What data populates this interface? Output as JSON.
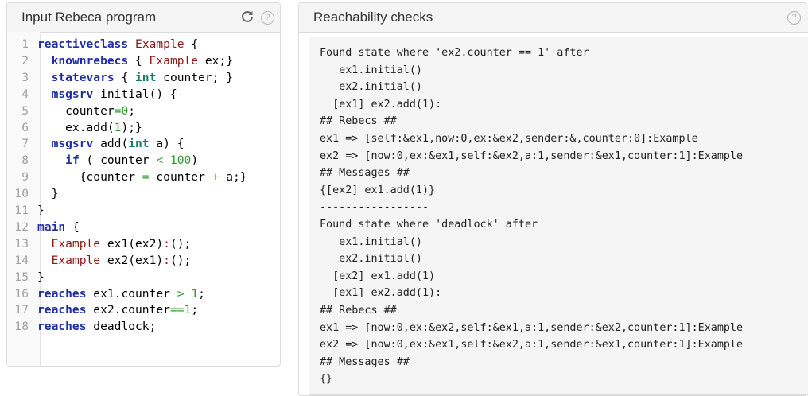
{
  "left_panel": {
    "title": "Input Rebeca program",
    "help": "?",
    "lines": [
      {
        "n": "1",
        "tokens": [
          {
            "c": "kw",
            "t": "reactiveclass"
          },
          {
            "c": "code",
            "t": " "
          },
          {
            "c": "cls",
            "t": "Example"
          },
          {
            "c": "code",
            "t": " {"
          }
        ]
      },
      {
        "n": "2",
        "tokens": [
          {
            "c": "code",
            "t": "  "
          },
          {
            "c": "kw",
            "t": "knownrebecs"
          },
          {
            "c": "code",
            "t": " { "
          },
          {
            "c": "cls",
            "t": "Example"
          },
          {
            "c": "code",
            "t": " ex;}"
          }
        ]
      },
      {
        "n": "3",
        "tokens": [
          {
            "c": "code",
            "t": "  "
          },
          {
            "c": "kw",
            "t": "statevars"
          },
          {
            "c": "code",
            "t": " { "
          },
          {
            "c": "typ",
            "t": "int"
          },
          {
            "c": "code",
            "t": " counter; }"
          }
        ]
      },
      {
        "n": "4",
        "tokens": [
          {
            "c": "code",
            "t": "  "
          },
          {
            "c": "kw",
            "t": "msgsrv"
          },
          {
            "c": "code",
            "t": " initial() {"
          }
        ]
      },
      {
        "n": "5",
        "tokens": [
          {
            "c": "code",
            "t": "    counter"
          },
          {
            "c": "op",
            "t": "="
          },
          {
            "c": "num",
            "t": "0"
          },
          {
            "c": "code",
            "t": ";"
          }
        ]
      },
      {
        "n": "6",
        "tokens": [
          {
            "c": "code",
            "t": "    ex.add("
          },
          {
            "c": "num",
            "t": "1"
          },
          {
            "c": "code",
            "t": ");}"
          }
        ]
      },
      {
        "n": "7",
        "tokens": [
          {
            "c": "code",
            "t": "  "
          },
          {
            "c": "kw",
            "t": "msgsrv"
          },
          {
            "c": "code",
            "t": " add("
          },
          {
            "c": "typ",
            "t": "int"
          },
          {
            "c": "code",
            "t": " a) {"
          }
        ]
      },
      {
        "n": "8",
        "tokens": [
          {
            "c": "code",
            "t": "    "
          },
          {
            "c": "kw",
            "t": "if"
          },
          {
            "c": "code",
            "t": " ( counter "
          },
          {
            "c": "op",
            "t": "<"
          },
          {
            "c": "code",
            "t": " "
          },
          {
            "c": "num",
            "t": "100"
          },
          {
            "c": "code",
            "t": ")"
          }
        ]
      },
      {
        "n": "9",
        "tokens": [
          {
            "c": "code",
            "t": "      {counter "
          },
          {
            "c": "op",
            "t": "="
          },
          {
            "c": "code",
            "t": " counter "
          },
          {
            "c": "op",
            "t": "+"
          },
          {
            "c": "code",
            "t": " a;}"
          }
        ]
      },
      {
        "n": "10",
        "tokens": [
          {
            "c": "code",
            "t": "  }"
          }
        ]
      },
      {
        "n": "11",
        "tokens": [
          {
            "c": "code",
            "t": "}"
          }
        ]
      },
      {
        "n": "12",
        "tokens": [
          {
            "c": "kw",
            "t": "main"
          },
          {
            "c": "code",
            "t": " {"
          }
        ]
      },
      {
        "n": "13",
        "tokens": [
          {
            "c": "code",
            "t": "  "
          },
          {
            "c": "cls",
            "t": "Example"
          },
          {
            "c": "code",
            "t": " ex1(ex2)"
          },
          {
            "c": "cls",
            "t": ":"
          },
          {
            "c": "code",
            "t": "();"
          }
        ]
      },
      {
        "n": "14",
        "tokens": [
          {
            "c": "code",
            "t": "  "
          },
          {
            "c": "cls",
            "t": "Example"
          },
          {
            "c": "code",
            "t": " ex2(ex1)"
          },
          {
            "c": "cls",
            "t": ":"
          },
          {
            "c": "code",
            "t": "();"
          }
        ]
      },
      {
        "n": "15",
        "tokens": [
          {
            "c": "code",
            "t": "}"
          }
        ]
      },
      {
        "n": "16",
        "tokens": [
          {
            "c": "kw",
            "t": "reaches"
          },
          {
            "c": "code",
            "t": " ex1.counter "
          },
          {
            "c": "op",
            "t": ">"
          },
          {
            "c": "code",
            "t": " "
          },
          {
            "c": "num",
            "t": "1"
          },
          {
            "c": "code",
            "t": ";"
          }
        ]
      },
      {
        "n": "17",
        "tokens": [
          {
            "c": "kw",
            "t": "reaches"
          },
          {
            "c": "code",
            "t": " ex2.counter"
          },
          {
            "c": "op",
            "t": "=="
          },
          {
            "c": "num",
            "t": "1"
          },
          {
            "c": "code",
            "t": ";"
          }
        ]
      },
      {
        "n": "18",
        "tokens": [
          {
            "c": "kw",
            "t": "reaches"
          },
          {
            "c": "code",
            "t": " deadlock;"
          }
        ]
      }
    ]
  },
  "right_panel": {
    "title": "Reachability checks",
    "help": "?",
    "output_lines": [
      "Found state where 'ex2.counter == 1' after",
      "   ex1.initial()",
      "   ex2.initial()",
      "  [ex1] ex2.add(1):",
      "## Rebecs ##",
      "ex1 => [self:&ex1,now:0,ex:&ex2,sender:&,counter:0]:Example",
      "ex2 => [now:0,ex:&ex1,self:&ex2,a:1,sender:&ex1,counter:1]:Example",
      "## Messages ##",
      "{[ex2] ex1.add(1)}",
      "-----------------",
      "Found state where 'deadlock' after",
      "   ex1.initial()",
      "   ex2.initial()",
      "  [ex2] ex1.add(1)",
      "  [ex1] ex2.add(1):",
      "## Rebecs ##",
      "ex1 => [now:0,ex:&ex2,self:&ex1,a:1,sender:&ex2,counter:1]:Example",
      "ex2 => [now:0,ex:&ex1,self:&ex2,a:1,sender:&ex1,counter:1]:Example",
      "## Messages ##",
      "{}"
    ]
  }
}
